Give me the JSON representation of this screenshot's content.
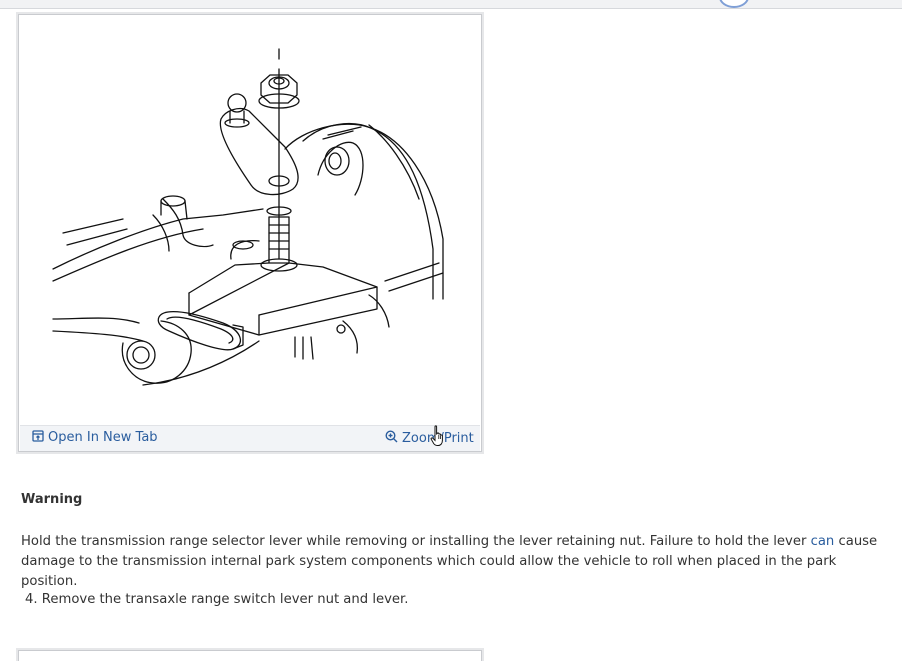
{
  "figure": {
    "open_tab_label": "Open In New Tab",
    "zoom_print_label": "Zoom/Print"
  },
  "warning": {
    "title": "Warning",
    "text_before_link": "Hold the transmission range selector lever while removing or installing the lever retaining nut. Failure to hold the lever ",
    "link_word": "can",
    "text_after_link": " cause damage to the transmission internal park system components which could allow the vehicle to roll when placed in the park position."
  },
  "steps": [
    {
      "number": "4.",
      "text": "Remove the transaxle range switch lever nut and lever."
    }
  ],
  "icons": {
    "open_tab": "open-in-new-tab-icon",
    "zoom": "zoom-in-icon",
    "cursor": "hand-pointer-cursor"
  },
  "colors": {
    "link": "#2a5d9e",
    "text": "#333333",
    "footer_bg": "#f2f4f7"
  }
}
